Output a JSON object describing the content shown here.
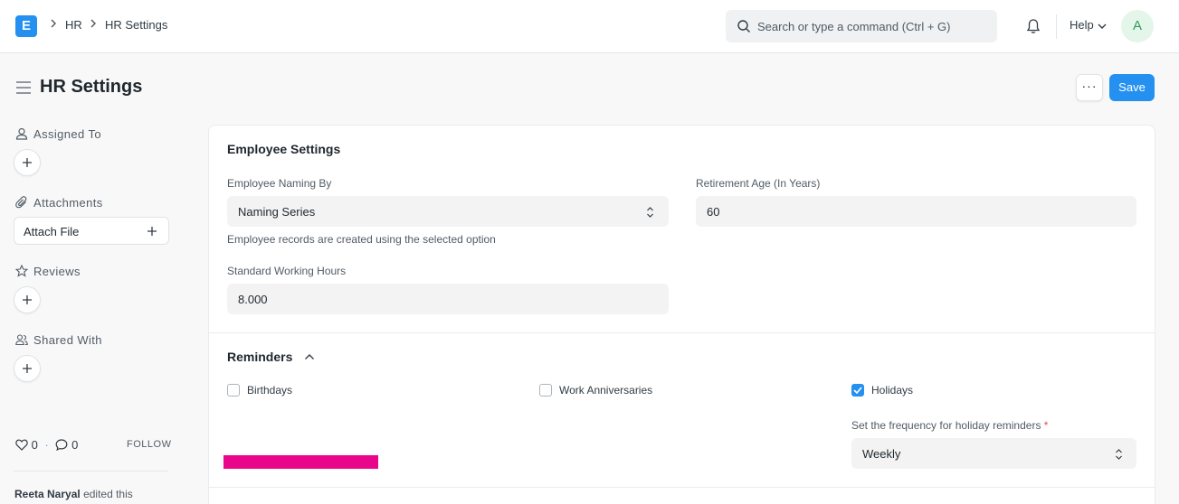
{
  "navbar": {
    "logo_letter": "E",
    "breadcrumbs": [
      "HR",
      "HR Settings"
    ],
    "search_placeholder": "Search or type a command (Ctrl + G)",
    "help_label": "Help",
    "avatar_initial": "A"
  },
  "page": {
    "title": "HR Settings",
    "more_label": "···",
    "save_label": "Save"
  },
  "sidebar": {
    "assigned_to": "Assigned To",
    "attachments": "Attachments",
    "attach_file": "Attach File",
    "reviews": "Reviews",
    "shared_with": "Shared With",
    "likes_count": "0",
    "comments_count": "0",
    "follow_label": "FOLLOW",
    "activity_user": "Reeta Naryal",
    "activity_text": "edited this"
  },
  "employee_settings": {
    "title": "Employee Settings",
    "naming_by_label": "Employee Naming By",
    "naming_by_value": "Naming Series",
    "naming_by_desc": "Employee records are created using the selected option",
    "retirement_label": "Retirement Age (In Years)",
    "retirement_value": "60",
    "working_hours_label": "Standard Working Hours",
    "working_hours_value": "8.000"
  },
  "reminders": {
    "title": "Reminders",
    "birthdays_label": "Birthdays",
    "birthdays_checked": false,
    "anniversaries_label": "Work Anniversaries",
    "anniversaries_checked": false,
    "holidays_label": "Holidays",
    "holidays_checked": true,
    "frequency_label": "Set the frequency for holiday reminders",
    "frequency_required": "*",
    "frequency_value": "Weekly"
  },
  "colors": {
    "accent": "#2490ef",
    "highlight_bar": "#e8068a"
  }
}
